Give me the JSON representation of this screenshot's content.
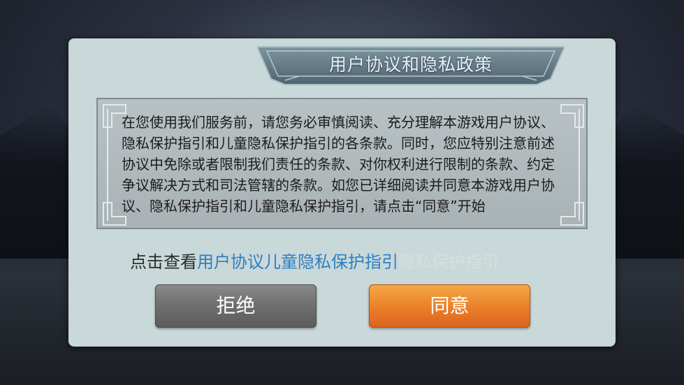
{
  "dialog": {
    "title": "用户协议和隐私政策",
    "content": "在您使用我们服务前，请您务必审慎阅读、充分理解本游戏用户协议、隐私保护指引和儿童隐私保护指引的各条款。同时，您应特别注意前述协议中免除或者限制我们责任的条款、对你权利进行限制的条款、约定争议解决方式和司法管辖的条款。如您已详细阅读并同意本游戏用户协议、隐私保护指引和儿童隐私保护指引，请点击“同意”开始",
    "link_prefix": "点击查看",
    "link_user_agreement": "用户协议",
    "link_child_privacy": "儿童隐私保护指引",
    "link_privacy": "隐私保护指引",
    "reject_label": "拒绝",
    "agree_label": "同意"
  },
  "colors": {
    "dialog_bg": "#c9d8d8",
    "link": "#2d7fc4",
    "agree_button": "#ea7f2a",
    "reject_button": "#6e6e6e"
  }
}
